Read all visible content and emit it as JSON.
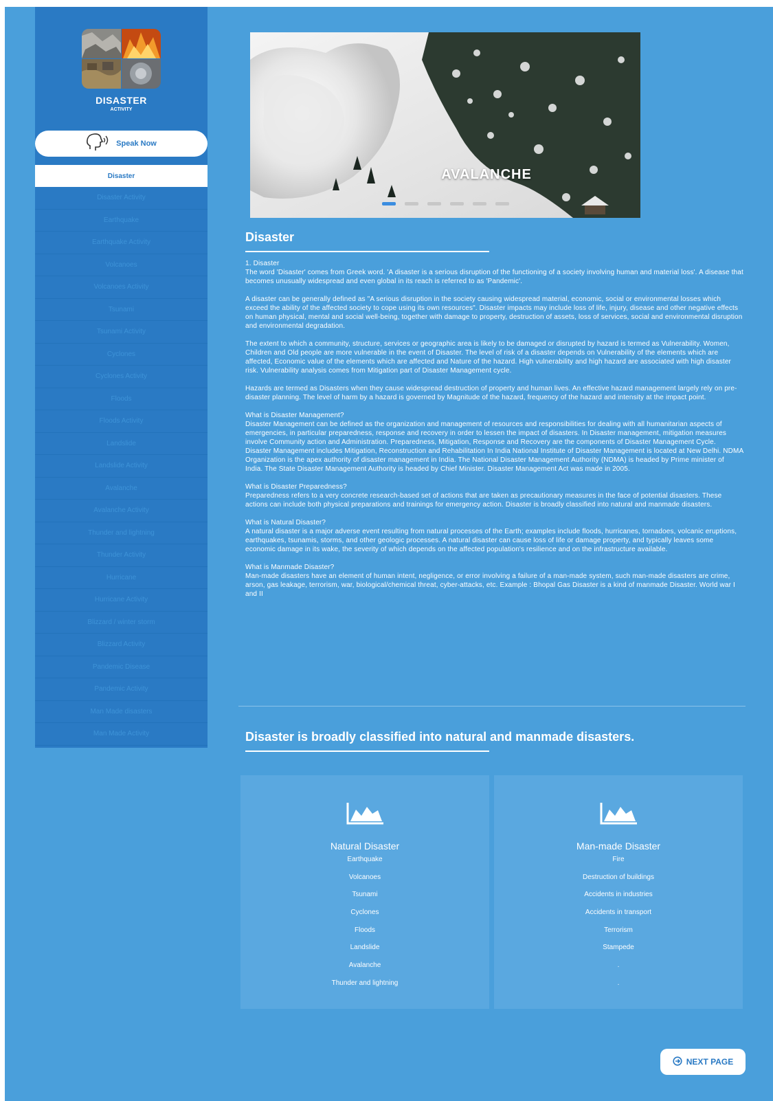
{
  "sidebar": {
    "title": "DISASTER",
    "subtitle": "ACTIVITY",
    "speak_label": "Speak Now",
    "items": [
      {
        "label": "Disaster"
      },
      {
        "label": "Disaster Activity"
      },
      {
        "label": "Earthquake"
      },
      {
        "label": "Earthquake Activity"
      },
      {
        "label": "Volcanoes"
      },
      {
        "label": "Volcanoes Activity"
      },
      {
        "label": "Tsunami"
      },
      {
        "label": "Tsunami Activity"
      },
      {
        "label": "Cyclones"
      },
      {
        "label": "Cyclones Activity"
      },
      {
        "label": "Floods"
      },
      {
        "label": "Floods Activity"
      },
      {
        "label": "Landslide"
      },
      {
        "label": "Landslide Activity"
      },
      {
        "label": "Avalanche"
      },
      {
        "label": "Avalanche Activity"
      },
      {
        "label": "Thunder and lightning"
      },
      {
        "label": "Thunder Activity"
      },
      {
        "label": "Hurricane"
      },
      {
        "label": "Hurricane Activity"
      },
      {
        "label": "Blizzard / winter storm"
      },
      {
        "label": "Blizzard Activity"
      },
      {
        "label": "Pandemic Disease"
      },
      {
        "label": "Pandemic Activity"
      },
      {
        "label": "Man Made disasters"
      },
      {
        "label": "Man Made Activity"
      }
    ],
    "active_index": 0
  },
  "hero": {
    "caption": "AVALANCHE",
    "slide_count": 6,
    "active_slide": 0
  },
  "main": {
    "section_title": "Disaster",
    "paragraphs": [
      "1. Disaster\nThe word 'Disaster' comes from Greek word. 'A disaster is a serious disruption of the functioning of a society involving human and material loss'. A disease that becomes unusually widespread and even global in its reach is referred to as 'Pandemic'.",
      "A disaster can be generally defined as \"A serious disruption in the society causing widespread material, economic, social or environmental losses which exceed the ability of the affected society to cope using its own resources\". Disaster impacts may include loss of life, injury, disease and other negative effects on human physical, mental and social well-being, together with damage to property, destruction of assets, loss of services, social and environmental disruption and environmental degradation.",
      "The extent to which a community, structure, services or geographic area is likely to be damaged or disrupted by hazard is termed as Vulnerability. Women, Children and Old people are more vulnerable in the event of Disaster. The level of risk of a disaster depends on Vulnerability of the elements which are affected, Economic value of the elements which are affected and Nature of the hazard. High vulnerability and high hazard are associated with high disaster risk. Vulnerability analysis comes from Mitigation part of Disaster Management cycle.",
      "Hazards are termed as Disasters when they cause widespread destruction of property and human lives. An effective hazard management largely rely on pre- disaster planning. The level of harm by a hazard is governed by Magnitude of the hazard, frequency of the hazard and intensity at the impact point.",
      "What is Disaster Management?\nDisaster Management can be defined as the organization and management of resources and responsibilities for dealing with all humanitarian aspects of emergencies, in particular preparedness, response and recovery in order to lessen the impact of disasters. In Disaster management, mitigation measures involve Community action and Administration. Preparedness, Mitigation, Response and Recovery are the components of Disaster Management Cycle. Disaster Management includes Mitigation, Reconstruction and Rehabilitation In India National Institute of Disaster Management is located at New Delhi. NDMA Organization is the apex authority of disaster management in India. The National Disaster Management Authority (NDMA) is headed by Prime minister of India. The State Disaster Management Authority is headed by Chief Minister. Disaster Management Act was made in 2005.",
      "What is Disaster Preparedness?\nPreparedness refers to a very concrete research-based set of actions that are taken as precautionary measures in the face of potential disasters. These actions can include both physical preparations and trainings for emergency action. Disaster is broadly classified into natural and manmade disasters.",
      "What is Natural Disaster?\nA natural disaster is a major adverse event resulting from natural processes of the Earth; examples include floods, hurricanes, tornadoes, volcanic eruptions, earthquakes, tsunamis, storms, and other geologic processes. A natural disaster can cause loss of life or damage property, and typically leaves some economic damage in its wake, the severity of which depends on the affected population's resilience and on the infrastructure available.",
      "What is Manmade Disaster?\nMan-made disasters have an element of human intent, negligence, or error involving a failure of a man-made system, such man-made disasters are crime, arson, gas leakage, terrorism, war, biological/chemical threat, cyber-attacks, etc. Example : Bhopal Gas Disaster is a kind of manmade Disaster. World war I and II"
    ],
    "classification_title": "Disaster is broadly classified into natural and manmade disasters.",
    "natural": {
      "title": "Natural Disaster",
      "items": [
        "Earthquake",
        "Volcanoes",
        "Tsunami",
        "Cyclones",
        "Floods",
        "Landslide",
        "Avalanche",
        "Thunder and lightning"
      ]
    },
    "manmade": {
      "title": "Man-made Disaster",
      "items": [
        "Fire",
        "Destruction of buildings",
        "Accidents in industries",
        "Accidents in transport",
        "Terrorism",
        "Stampede",
        ".",
        "."
      ]
    },
    "next_label": "NEXT PAGE"
  },
  "colors": {
    "page_bg": "#4a9fdb",
    "sidebar_bg": "#2a7ac4",
    "card_bg": "#5aa8e0",
    "accent": "#2a7ac4"
  }
}
